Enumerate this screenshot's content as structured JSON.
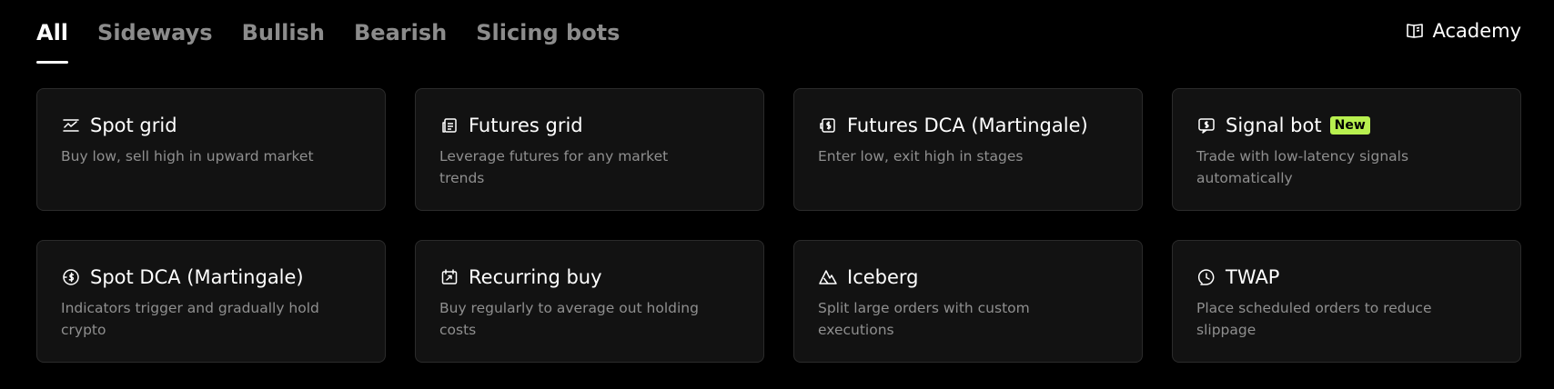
{
  "tabs": [
    {
      "label": "All",
      "active": true
    },
    {
      "label": "Sideways",
      "active": false
    },
    {
      "label": "Bullish",
      "active": false
    },
    {
      "label": "Bearish",
      "active": false
    },
    {
      "label": "Slicing bots",
      "active": false
    }
  ],
  "academy": {
    "label": "Academy",
    "icon": "book-icon"
  },
  "colors": {
    "background": "#000000",
    "card": "#121212",
    "badge": "#b8f04f",
    "muted_text": "#8f8f8f"
  },
  "bots": [
    {
      "title": "Spot grid",
      "desc": "Buy low, sell high in upward market",
      "icon": "spot-grid-icon"
    },
    {
      "title": "Futures grid",
      "desc": "Leverage futures for any market trends",
      "icon": "futures-grid-icon"
    },
    {
      "title": "Futures DCA (Martingale)",
      "desc": "Enter low, exit high in stages",
      "icon": "futures-dca-icon"
    },
    {
      "title": "Signal bot",
      "badge": "New",
      "desc": "Trade with low-latency signals automatically",
      "icon": "signal-bot-icon"
    },
    {
      "title": "Spot DCA (Martingale)",
      "desc": "Indicators trigger and gradually hold crypto",
      "icon": "spot-dca-icon"
    },
    {
      "title": "Recurring buy",
      "desc": "Buy regularly to average out holding costs",
      "icon": "recurring-buy-icon"
    },
    {
      "title": "Iceberg",
      "desc": "Split large orders with custom executions",
      "icon": "iceberg-icon"
    },
    {
      "title": "TWAP",
      "desc": "Place scheduled orders to reduce slippage",
      "icon": "twap-icon"
    }
  ]
}
